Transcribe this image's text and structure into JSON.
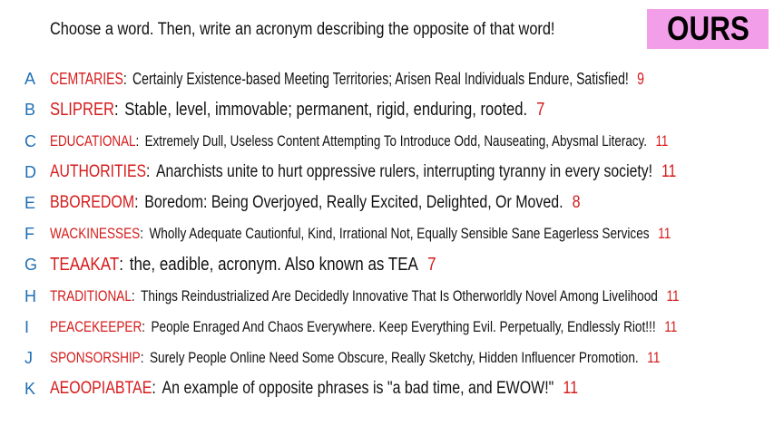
{
  "header": {
    "prompt": "Choose a word. Then, write an acronym describing the opposite of that word!",
    "badge": "OURS",
    "badge_color": "#f29ee8"
  },
  "colors": {
    "letter": "#1f6fb5",
    "word": "#d61b1b",
    "count": "#d61b1b",
    "text": "#111111"
  },
  "entries": [
    {
      "letter": "A",
      "word": "CEMTARIES",
      "desc": "Certainly Existence-based Meeting Territories; Arisen Real Individuals Endure, Satisfied!",
      "count": "9"
    },
    {
      "letter": "B",
      "word": "SLIPRER",
      "desc": "Stable, level, immovable; permanent, rigid, enduring, rooted.",
      "count": "7"
    },
    {
      "letter": "C",
      "word": "EDUCATIONAL",
      "desc": "Extremely Dull, Useless Content Attempting To Introduce Odd, Nauseating, Abysmal Literacy.",
      "count": "11"
    },
    {
      "letter": "D",
      "word": "AUTHORITIES",
      "desc": "Anarchists unite to hurt oppressive rulers, interrupting tyranny in every society!",
      "count": "11"
    },
    {
      "letter": "E",
      "word": "BBOREDOM",
      "desc": "Boredom: Being Overjoyed, Really Excited, Delighted, Or Moved.",
      "count": "8"
    },
    {
      "letter": "F",
      "word": "WACKINESSES",
      "desc": "Wholly Adequate Cautionful, Kind, Irrational Not, Equally Sensible Sane Eagerless Services",
      "count": "11"
    },
    {
      "letter": "G",
      "word": "TEAAKAT",
      "desc": "the, eadible, acronym. Also known as TEA",
      "count": "7"
    },
    {
      "letter": "H",
      "word": "TRADITIONAL",
      "desc": "Things Reindustrialized Are Decidedly Innovative That Is Otherworldly Novel Among Livelihood",
      "count": "11"
    },
    {
      "letter": "I",
      "word": "PEACEKEEPER",
      "desc": "People Enraged And Chaos Everywhere. Keep Everything Evil. Perpetually, Endlessly Riot!!!",
      "count": "11"
    },
    {
      "letter": "J",
      "word": "SPONSORSHIP",
      "desc": "Surely People Online Need Some Obscure, Really Sketchy, Hidden Influencer Promotion.",
      "count": "11"
    },
    {
      "letter": "K",
      "word": "AEOOPIABTAE",
      "desc": "An example of opposite phrases is \"a bad time, and EWOW!\"",
      "count": "11"
    }
  ]
}
